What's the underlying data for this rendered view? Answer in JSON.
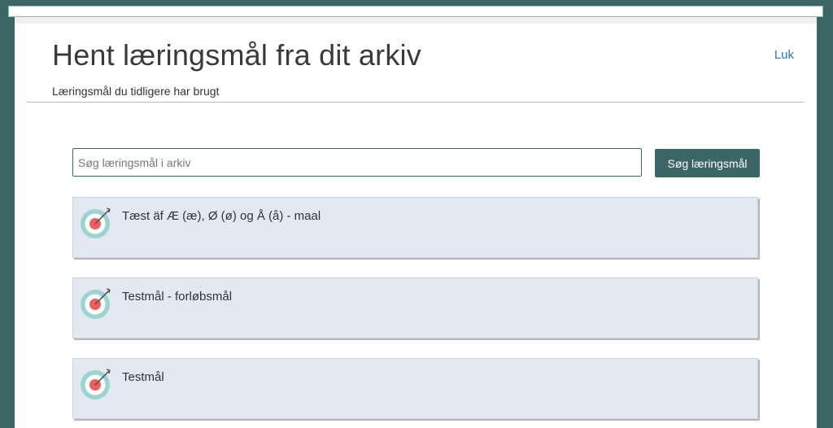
{
  "dialog": {
    "title": "Hent læringsmål fra dit arkiv",
    "subtitle": "Læringsmål du tidligere har brugt",
    "close_label": "Luk"
  },
  "search": {
    "placeholder": "Søg læringsmål i arkiv",
    "value": "",
    "button_label": "Søg læringsmål"
  },
  "goals": [
    {
      "title": "Tæst äf Æ (æ), Ø (ø) og Å (å) - maal",
      "icon": "target-icon"
    },
    {
      "title": "Testmål - forløbsmål",
      "icon": "target-icon"
    },
    {
      "title": "Testmål",
      "icon": "target-icon"
    }
  ],
  "colors": {
    "backdrop": "#3c6566",
    "accent": "#3c6566",
    "link": "#2a78b5",
    "card_background": "#e3e9f2",
    "target_ring": "#9fd3d0",
    "target_center": "#e8605f"
  }
}
